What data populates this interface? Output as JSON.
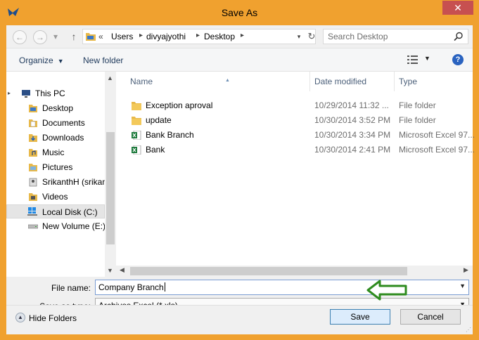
{
  "window": {
    "title": "Save As",
    "close_label": "✕"
  },
  "address": {
    "crumbs": [
      "Users",
      "divyajyothi",
      "Desktop"
    ],
    "prefix": "«"
  },
  "search": {
    "placeholder": "Search Desktop"
  },
  "commands": {
    "organize": "Organize",
    "new_folder": "New folder"
  },
  "nav": {
    "items": [
      {
        "label": "This PC",
        "icon": "pc-icon"
      },
      {
        "label": "Desktop",
        "icon": "desktop-folder-icon"
      },
      {
        "label": "Documents",
        "icon": "documents-folder-icon"
      },
      {
        "label": "Downloads",
        "icon": "downloads-folder-icon"
      },
      {
        "label": "Music",
        "icon": "music-folder-icon"
      },
      {
        "label": "Pictures",
        "icon": "pictures-folder-icon"
      },
      {
        "label": "SrikanthH (srikan",
        "icon": "user-folder-icon"
      },
      {
        "label": "Videos",
        "icon": "videos-folder-icon"
      },
      {
        "label": "Local Disk (C:)",
        "icon": "local-disk-icon",
        "selected": true
      },
      {
        "label": "New Volume (E:)",
        "icon": "drive-icon"
      }
    ]
  },
  "columns": {
    "name": "Name",
    "date": "Date modified",
    "type": "Type"
  },
  "files": [
    {
      "name": "Exception aproval",
      "date": "10/29/2014 11:32 ...",
      "type": "File folder",
      "icon": "folder-icon"
    },
    {
      "name": "update",
      "date": "10/30/2014 3:52 PM",
      "type": "File folder",
      "icon": "folder-icon"
    },
    {
      "name": "Bank Branch",
      "date": "10/30/2014 3:34 PM",
      "type": "Microsoft Excel 97...",
      "icon": "excel-file-icon"
    },
    {
      "name": "Bank",
      "date": "10/30/2014 2:41 PM",
      "type": "Microsoft Excel 97...",
      "icon": "excel-file-icon"
    }
  ],
  "fields": {
    "file_name_label": "File name:",
    "file_name_value": "Company Branch",
    "save_type_label": "Save as type:",
    "save_type_value": "Archivos Excel (*.xls)"
  },
  "footer": {
    "hide_folders": "Hide Folders",
    "save": "Save",
    "cancel": "Cancel"
  },
  "colors": {
    "titlebar": "#f0a12f",
    "close": "#c75050",
    "annotation_arrow": "#2e8b1e"
  }
}
